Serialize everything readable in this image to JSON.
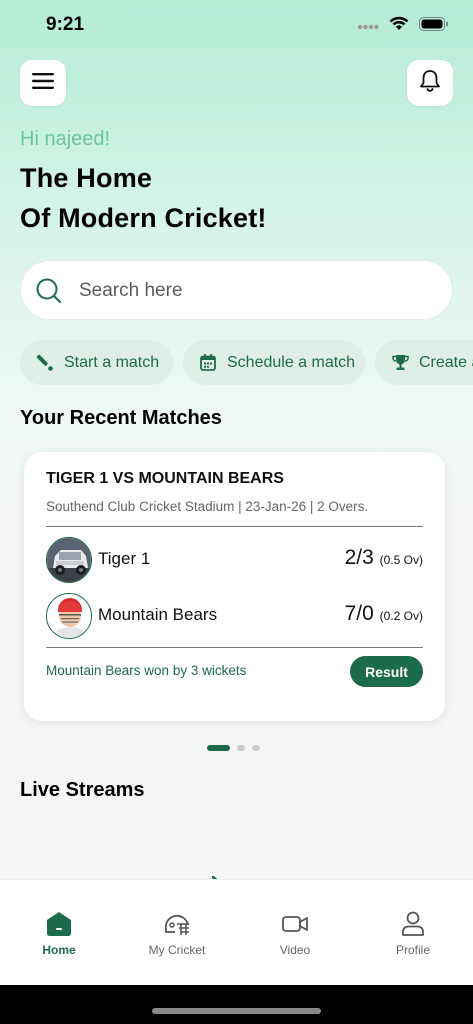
{
  "status_bar": {
    "time": "9:21"
  },
  "header": {
    "greeting": "Hi najeed!",
    "headline_line1": "The Home",
    "headline_line2": "Of Modern Cricket!"
  },
  "search": {
    "placeholder": "Search here"
  },
  "quick_actions": [
    {
      "label": "Start a match",
      "icon": "bat-icon"
    },
    {
      "label": "Schedule a match",
      "icon": "calendar-icon"
    },
    {
      "label": "Create a tournament",
      "icon": "trophy-icon"
    }
  ],
  "recent_matches": {
    "section_title": "Your Recent Matches",
    "match": {
      "title": "TIGER 1 VS MOUNTAIN BEARS",
      "meta": "Southend Club Cricket Stadium | 23-Jan-26 | 2 Overs.",
      "teams": [
        {
          "name": "Tiger 1",
          "score": "2/3",
          "overs": "(0.5 Ov)"
        },
        {
          "name": "Mountain Bears",
          "score": "7/0",
          "overs": "(0.2 Ov)"
        }
      ],
      "result_text": "Mountain Bears won by 3 wickets",
      "result_button": "Result"
    },
    "carousel": {
      "total": 3,
      "active": 1
    }
  },
  "live_streams": {
    "section_title": "Live Streams"
  },
  "tab_bar": [
    {
      "label": "Home",
      "icon": "home-icon",
      "active": true
    },
    {
      "label": "My Cricket",
      "icon": "helmet-icon",
      "active": false
    },
    {
      "label": "Video",
      "icon": "video-icon",
      "active": false
    },
    {
      "label": "Profile",
      "icon": "profile-icon",
      "active": false
    }
  ],
  "colors": {
    "accent": "#1d6b4d",
    "greeting": "#6cc3a1",
    "chip_bg": "#dfeee7"
  }
}
